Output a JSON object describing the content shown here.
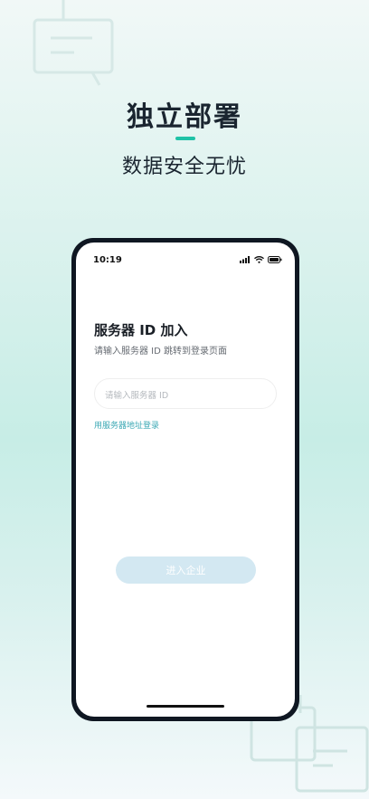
{
  "promo": {
    "headline": "独立部署",
    "subheadline": "数据安全无忧"
  },
  "status_bar": {
    "time": "10:19",
    "icons": [
      "signal-icon",
      "wifi-icon",
      "battery-icon"
    ]
  },
  "form": {
    "title": "服务器 ID 加入",
    "subtitle": "请输入服务器 ID 跳转到登录页面",
    "input_placeholder": "请输入服务器 ID",
    "input_value": "",
    "address_login_link": "用服务器地址登录",
    "submit_label": "进入企业"
  },
  "colors": {
    "accent": "#1fc2a7",
    "link": "#3ba8b4",
    "button_disabled": "#d3e8f2",
    "phone_frame": "#0f1722"
  }
}
